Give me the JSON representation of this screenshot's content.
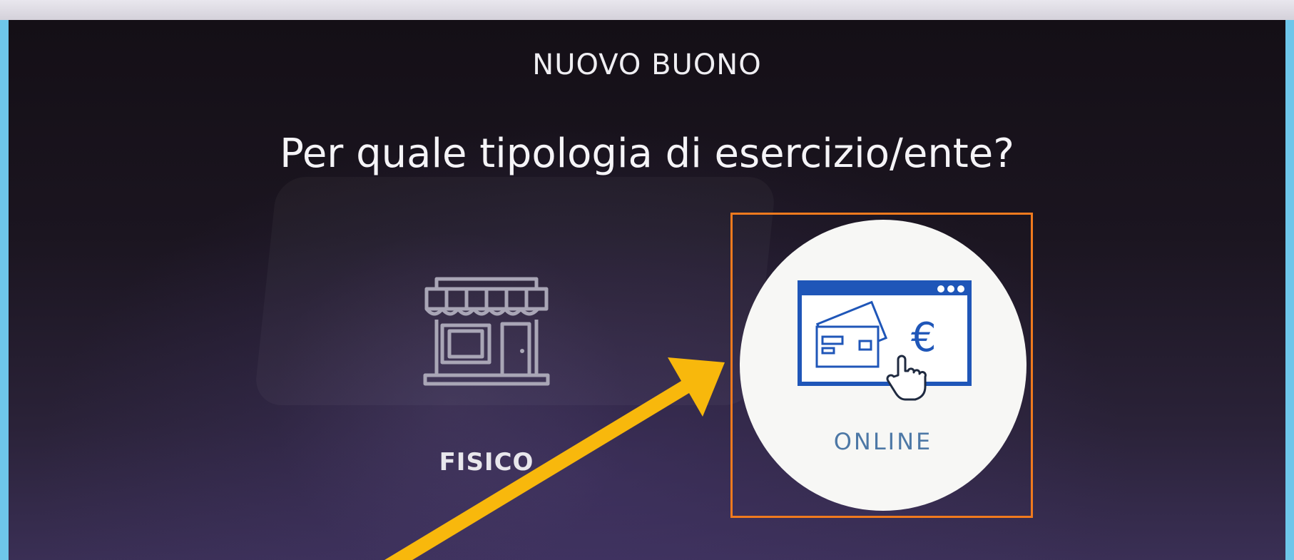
{
  "screen": {
    "section_title": "NUOVO BUONO",
    "question": "Per quale tipologia di esercizio/ente?"
  },
  "options": [
    {
      "label": "FISICO",
      "icon": "shop-icon",
      "selected": false
    },
    {
      "label": "ONLINE",
      "icon": "browser-payment-icon",
      "selected": true
    }
  ],
  "icons": {
    "euro_symbol": "€"
  },
  "colors": {
    "highlight_border": "#f07a1e",
    "annotation_arrow": "#f8b80c",
    "online_icon": "#1f56b8",
    "physical_icon": "#a9a6b6"
  }
}
